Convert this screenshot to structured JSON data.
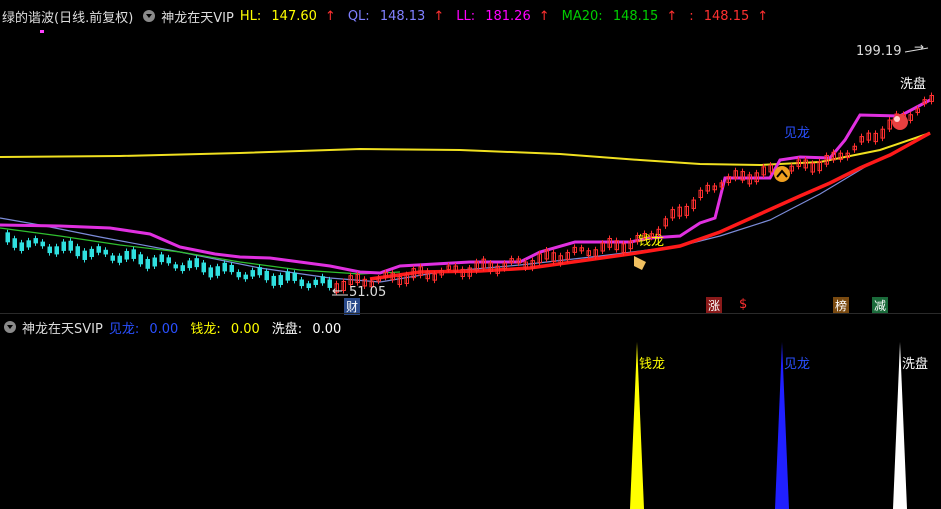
{
  "header": {
    "title": "绿的谐波(日线.前复权)",
    "indicator": "神龙在天VIP",
    "hl_label": "HL:",
    "hl_value": "147.60",
    "ql_label": "QL:",
    "ql_value": "148.13",
    "ll_label": "LL:",
    "ll_value": "181.26",
    "ma20_label": "MA20:",
    "ma20_value": "148.15",
    "extra_label": ":",
    "extra_value": "148.15",
    "arrow": "↑"
  },
  "chart_labels": {
    "high_price": "199.19",
    "low_price": "51.05",
    "low_arrow": "←",
    "high_arrow": "→",
    "qianlong": "钱龙",
    "jianlong": "见龙",
    "xipan": "洗盘",
    "cai": "财",
    "zhang": "涨",
    "dollar": "$",
    "bang": "榜",
    "jian": "减"
  },
  "sub_header": {
    "indicator": "神龙在天SVIP",
    "jianlong_label": "见龙:",
    "jianlong_value": "0.00",
    "qianlong_label": "钱龙:",
    "qianlong_value": "0.00",
    "xipan_label": "洗盘:",
    "xipan_value": "0.00"
  },
  "colors": {
    "hl": "#ffff00",
    "ql": "#8080ff",
    "ll": "#ff00ff",
    "ma20": "#00cc00",
    "extra": "#ff3030",
    "jianlong": "#2020ff",
    "qianlong": "#ffff00",
    "xipan": "#ffffff"
  }
}
